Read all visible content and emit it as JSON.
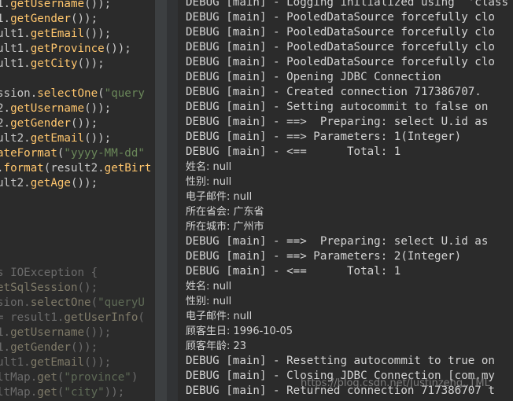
{
  "editor_lines": [
    [
      {
        "t": "1.",
        "c": "c-white"
      },
      {
        "t": "getUsername",
        "c": "c-fn"
      },
      {
        "t": "());",
        "c": "c-white"
      }
    ],
    [
      {
        "t": "1.",
        "c": "c-white"
      },
      {
        "t": "getGender",
        "c": "c-fn"
      },
      {
        "t": "());",
        "c": "c-white"
      }
    ],
    [
      {
        "t": "ult1.",
        "c": "c-white"
      },
      {
        "t": "getEmail",
        "c": "c-fn"
      },
      {
        "t": "());",
        "c": "c-white"
      }
    ],
    [
      {
        "t": "ult1.",
        "c": "c-white"
      },
      {
        "t": "getProvince",
        "c": "c-fn"
      },
      {
        "t": "());",
        "c": "c-white"
      }
    ],
    [
      {
        "t": "ult1.",
        "c": "c-white"
      },
      {
        "t": "getCity",
        "c": "c-fn"
      },
      {
        "t": "());",
        "c": "c-white"
      }
    ],
    [],
    [
      {
        "t": "ssion.",
        "c": "c-white"
      },
      {
        "t": "selectOne",
        "c": "c-fn"
      },
      {
        "t": "(",
        "c": "c-white"
      },
      {
        "t": "\"query",
        "c": "c-green"
      }
    ],
    [
      {
        "t": "2.",
        "c": "c-white"
      },
      {
        "t": "getUsername",
        "c": "c-fn"
      },
      {
        "t": "());",
        "c": "c-white"
      }
    ],
    [
      {
        "t": "2.",
        "c": "c-white"
      },
      {
        "t": "getGender",
        "c": "c-fn"
      },
      {
        "t": "());",
        "c": "c-white"
      }
    ],
    [
      {
        "t": "ult2.",
        "c": "c-white"
      },
      {
        "t": "getEmail",
        "c": "c-fn"
      },
      {
        "t": "());",
        "c": "c-white"
      }
    ],
    [
      {
        "t": "ateFormat",
        "c": "c-fn"
      },
      {
        "t": "(",
        "c": "c-white"
      },
      {
        "t": "\"yyyy-MM-dd\"",
        "c": "c-green"
      }
    ],
    [
      {
        "t": ".",
        "c": "c-white"
      },
      {
        "t": "format",
        "c": "c-fn"
      },
      {
        "t": "(result2.",
        "c": "c-white"
      },
      {
        "t": "getBirt",
        "c": "c-fn"
      }
    ],
    [
      {
        "t": "ult2.",
        "c": "c-white"
      },
      {
        "t": "getAge",
        "c": "c-fn"
      },
      {
        "t": "());",
        "c": "c-white"
      }
    ],
    [],
    [],
    [],
    [],
    [],
    [
      {
        "t": "s IOException {",
        "c": "c-dim"
      }
    ],
    [
      {
        "t": "etSqlSession",
        "c": "c-dimfn"
      },
      {
        "t": "();",
        "c": "c-dim"
      }
    ],
    [
      {
        "t": "sion.",
        "c": "c-dim"
      },
      {
        "t": "selectOne",
        "c": "c-dimfn"
      },
      {
        "t": "(",
        "c": "c-dim"
      },
      {
        "t": "\"queryU",
        "c": "c-dimstr"
      }
    ],
    [
      {
        "t": "= result1.",
        "c": "c-dim"
      },
      {
        "t": "getUserInfo",
        "c": "c-dimfn"
      },
      {
        "t": "(",
        "c": "c-dim"
      }
    ],
    [
      {
        "t": "1.",
        "c": "c-dim"
      },
      {
        "t": "getUsername",
        "c": "c-dimfn"
      },
      {
        "t": "());",
        "c": "c-dim"
      }
    ],
    [
      {
        "t": "1.",
        "c": "c-dim"
      },
      {
        "t": "getGender",
        "c": "c-dimfn"
      },
      {
        "t": "());",
        "c": "c-dim"
      }
    ],
    [
      {
        "t": "ult1.",
        "c": "c-dim"
      },
      {
        "t": "getEmail",
        "c": "c-dimfn"
      },
      {
        "t": "());",
        "c": "c-dim"
      }
    ],
    [
      {
        "t": "ltMap.",
        "c": "c-dim"
      },
      {
        "t": "get",
        "c": "c-dimfn"
      },
      {
        "t": "(",
        "c": "c-dim"
      },
      {
        "t": "\"province\"",
        "c": "c-dimstr"
      },
      {
        "t": ")",
        "c": "c-dim"
      }
    ],
    [
      {
        "t": "ltMap.",
        "c": "c-dim"
      },
      {
        "t": "get",
        "c": "c-dimfn"
      },
      {
        "t": "(",
        "c": "c-dim"
      },
      {
        "t": "\"city\"",
        "c": "c-dimstr"
      },
      {
        "t": "));",
        "c": "c-dim"
      }
    ]
  ],
  "console_lines": [
    {
      "text": "DEBUG [main] - Logging initialized using  'class",
      "zh": false
    },
    {
      "text": "DEBUG [main] - PooledDataSource forcefully clo",
      "zh": false
    },
    {
      "text": "DEBUG [main] - PooledDataSource forcefully clo",
      "zh": false
    },
    {
      "text": "DEBUG [main] - PooledDataSource forcefully clo",
      "zh": false
    },
    {
      "text": "DEBUG [main] - PooledDataSource forcefully clo",
      "zh": false
    },
    {
      "text": "DEBUG [main] - Opening JDBC Connection",
      "zh": false
    },
    {
      "text": "DEBUG [main] - Created connection 717386707.",
      "zh": false
    },
    {
      "text": "DEBUG [main] - Setting autocommit to false on",
      "zh": false
    },
    {
      "text": "DEBUG [main] - ==>  Preparing: select U.id as",
      "zh": false
    },
    {
      "text": "DEBUG [main] - ==> Parameters: 1(Integer)",
      "zh": false
    },
    {
      "text": "DEBUG [main] - <==      Total: 1",
      "zh": false
    },
    {
      "text": "姓名: null",
      "zh": true
    },
    {
      "text": "性别: null",
      "zh": true
    },
    {
      "text": "电子邮件: null",
      "zh": true
    },
    {
      "text": "所在省会: 广东省",
      "zh": true
    },
    {
      "text": "所在城市: 广州市",
      "zh": true
    },
    {
      "text": "DEBUG [main] - ==>  Preparing: select U.id as",
      "zh": false
    },
    {
      "text": "DEBUG [main] - ==> Parameters: 2(Integer)",
      "zh": false
    },
    {
      "text": "DEBUG [main] - <==      Total: 1",
      "zh": false
    },
    {
      "text": "姓名: null",
      "zh": true
    },
    {
      "text": "性别: null",
      "zh": true
    },
    {
      "text": "电子邮件: null",
      "zh": true
    },
    {
      "text": "顾客生日: 1996-10-05",
      "zh": true
    },
    {
      "text": "顾客年龄: 23",
      "zh": true
    },
    {
      "text": "DEBUG [main] - Resetting autocommit to true on",
      "zh": false
    },
    {
      "text": "DEBUG [main] - Closing JDBC Connection [com.my",
      "zh": false
    },
    {
      "text": "DEBUG [main] - Returned connection 717386707 t",
      "zh": false
    }
  ],
  "watermark": "https://blog.csdn.net/Justinzeng..TML"
}
